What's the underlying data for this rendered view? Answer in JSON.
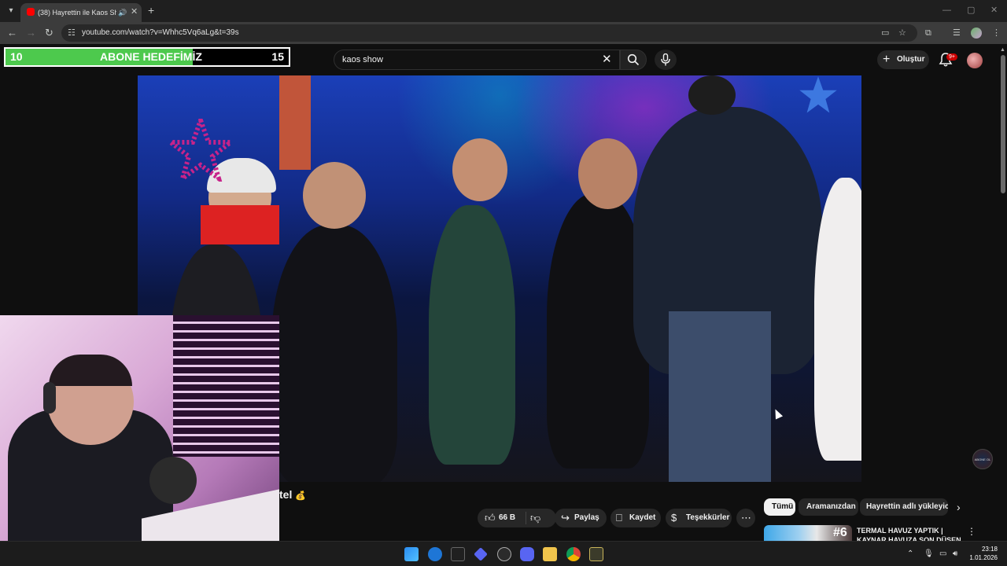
{
  "browser": {
    "tab_title": "(38) Hayrettin ile Kaos Show",
    "url": "youtube.com/watch?v=Whhc5Vq6aLg&t=39s"
  },
  "subscriber_goal": {
    "start": "10",
    "label": "ABONE HEDEFİMİZ",
    "end": "15",
    "progress_fraction": 0.66
  },
  "search": {
    "query": "kaos show"
  },
  "header": {
    "create_label": "Oluştur",
    "notifications_badge": "9+"
  },
  "video": {
    "title_fragment": "tel",
    "title_emoji": "💰",
    "corner_badge": "ABONE OL"
  },
  "actions": {
    "like_count": "66 B",
    "share_label": "Paylaş",
    "save_label": "Kaydet",
    "thanks_label": "Teşekkürler"
  },
  "chips": [
    {
      "label": "Tümü"
    },
    {
      "label": "Aramanızdan"
    },
    {
      "label": "Hayrettin adlı yükleyicid"
    }
  ],
  "recommendation": {
    "badge": "#6",
    "title": "TERMAL HAVUZ YAPTIK | KAYNAR HAVUZA SON DÜŞEN"
  },
  "taskbar": {
    "time": "23:18",
    "date": "1.01.2026"
  },
  "colors": {
    "goal_fill": "#4dc94d",
    "youtube_red": "#ff0000",
    "background": "#0f0f0f"
  }
}
